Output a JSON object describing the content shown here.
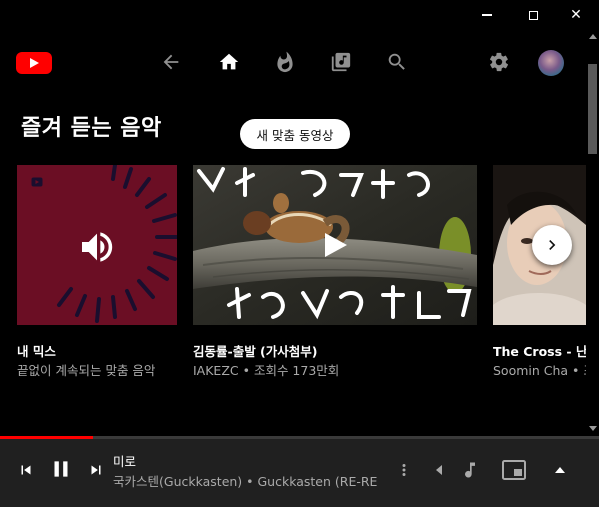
{
  "window": {
    "minimize_label": "minimize",
    "maximize_label": "maximize",
    "close_label": "✕"
  },
  "header": {
    "logo": "youtube-logo",
    "nav": [
      "back-arrow-icon",
      "home-icon",
      "trending-fire-icon",
      "library-music-icon",
      "search-icon"
    ],
    "settings": "gear-icon",
    "colors": {
      "logo_red": "#ff0000",
      "active_nav": "#ffffff",
      "inactive_nav": "#909090"
    }
  },
  "section": {
    "title": "즐겨 듣는 음악",
    "new_videos_pill": "새 맞춤 동영상"
  },
  "cards": [
    {
      "title": "내 믹스",
      "subtitle": "끝없이 계속되는 맞춤 음악",
      "thumb_color": "#6b0e24"
    },
    {
      "title": "김동률-출발 (가사첨부)",
      "subtitle": "IAKEZC • 조회수 173만회"
    },
    {
      "title": "The Cross - 난",
      "subtitle": "Soomin Cha • 조"
    }
  ],
  "player": {
    "title": "미로",
    "artist": "국카스텐(Guckkasten) • Guckkasten (RE-RE",
    "progress_fraction": 0.155,
    "accent": "#ff0000"
  }
}
